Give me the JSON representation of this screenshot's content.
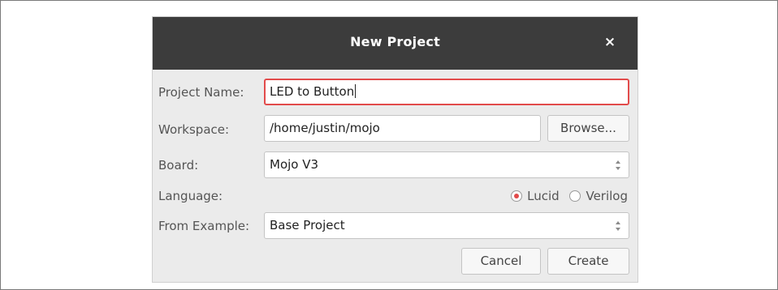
{
  "dialog": {
    "title": "New Project",
    "close_symbol": "×"
  },
  "form": {
    "project_name": {
      "label": "Project Name:",
      "value": "LED to Button"
    },
    "workspace": {
      "label": "Workspace:",
      "value": "/home/justin/mojo",
      "browse_label": "Browse..."
    },
    "board": {
      "label": "Board:",
      "value": "Mojo V3"
    },
    "language": {
      "label": "Language:",
      "options": [
        "Lucid",
        "Verilog"
      ],
      "selected": "Lucid"
    },
    "from_example": {
      "label": "From Example:",
      "value": "Base Project"
    }
  },
  "actions": {
    "cancel_label": "Cancel",
    "create_label": "Create"
  },
  "colors": {
    "titlebar": "#3c3c3c",
    "accent": "#e24b4b",
    "dialog_bg": "#ebebeb"
  },
  "icons": {
    "close": "close-icon",
    "select_arrows": "updown-arrows-icon"
  }
}
